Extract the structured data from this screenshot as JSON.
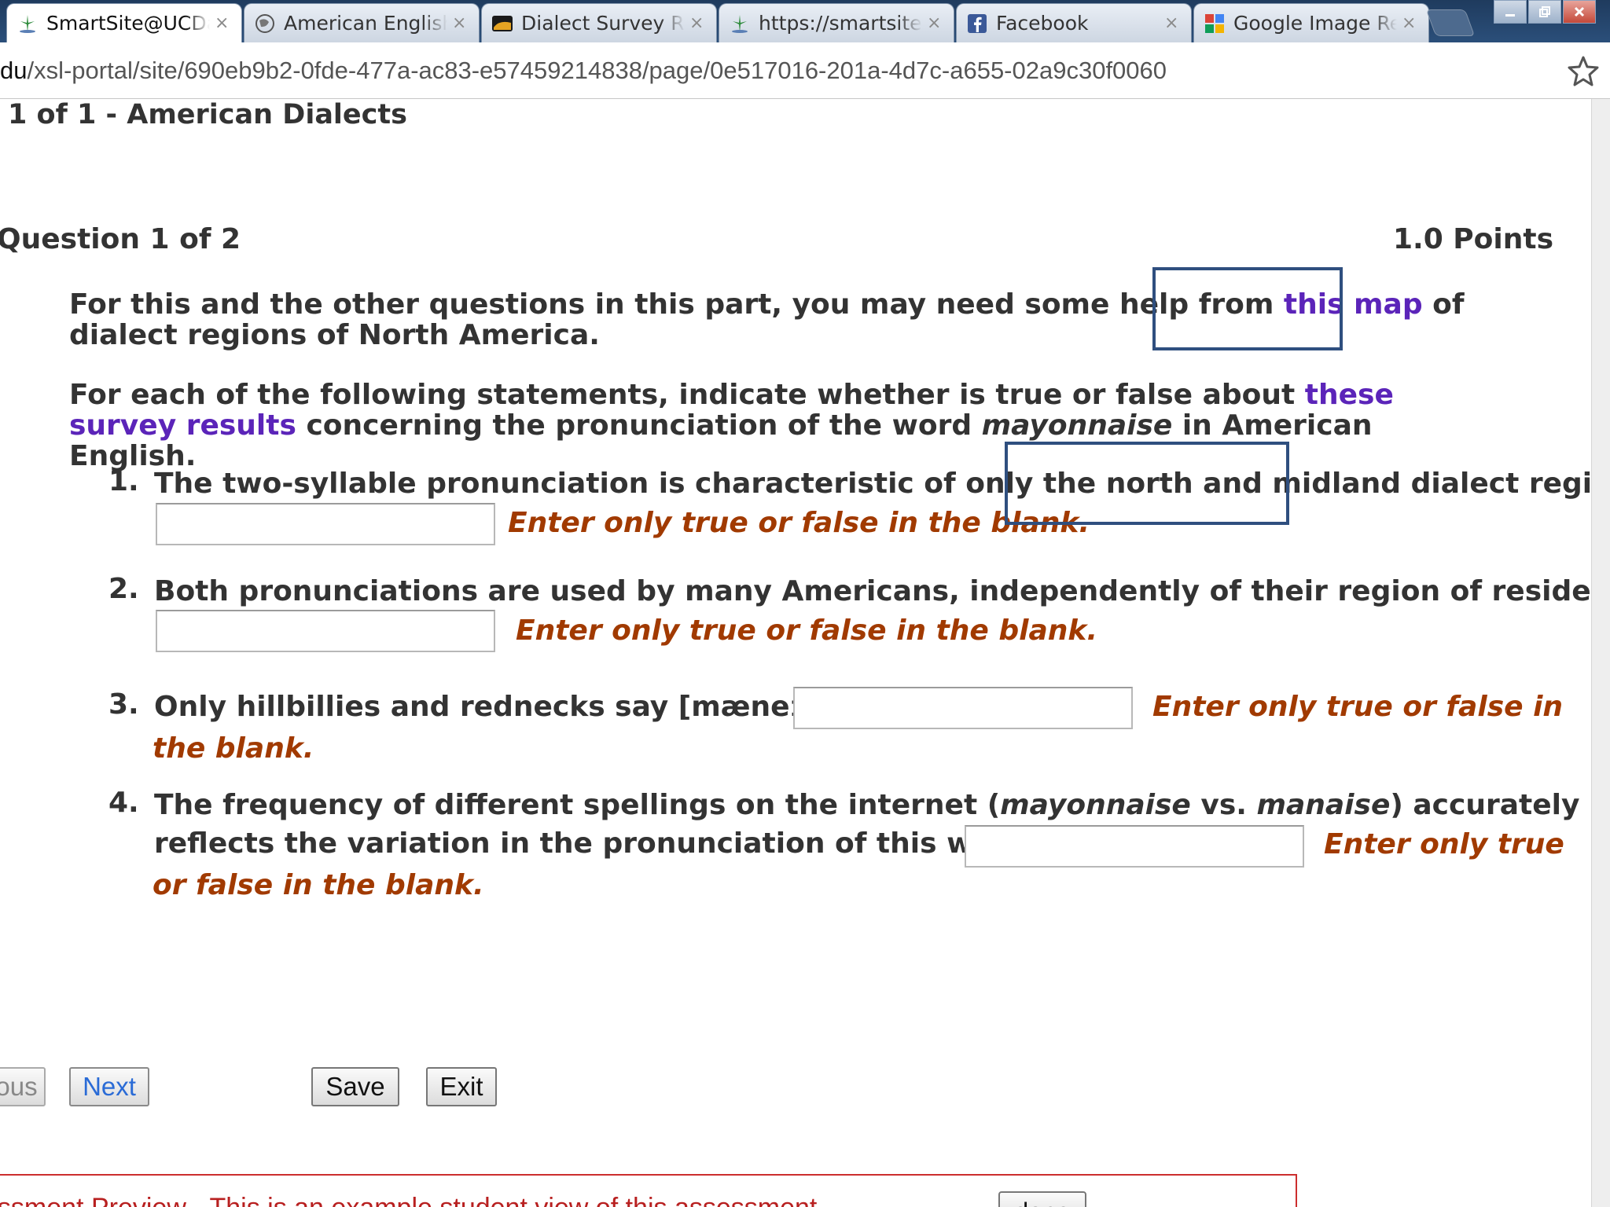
{
  "browser": {
    "tabs": [
      {
        "title": "SmartSite@UCDavis",
        "icon": "smartsite-icon",
        "active": true
      },
      {
        "title": "American English",
        "icon": "globe-icon",
        "active": false
      },
      {
        "title": "Dialect Survey Results",
        "icon": "dialect-survey-icon",
        "active": false
      },
      {
        "title": "https://smartsite.ucdavis.edu",
        "icon": "smartsite-icon",
        "active": false
      },
      {
        "title": "Facebook",
        "icon": "facebook-icon",
        "active": false
      },
      {
        "title": "Google Image Results",
        "icon": "google-icon",
        "active": false
      }
    ],
    "close_glyph": "×",
    "url_prefix": "du",
    "url_rest": "/xsl-portal/site/690eb9b2-0fde-477a-ac83-e57459214838/page/0e517016-201a-4d7c-a655-02a9c30f0060"
  },
  "page": {
    "part_title": "1 of 1 - American Dialects",
    "question_title": "Question 1 of 2",
    "points": "1.0 Points",
    "intro1": {
      "before": "For this and the other questions in this part, you may need some help from ",
      "link": "this map",
      "after": " of dialect regions of North America."
    },
    "intro2": {
      "before": "For each of the following statements, indicate whether is true or false about ",
      "link": "these survey results",
      "middle": " concerning the pronunciation of the word ",
      "word": "mayonnaise",
      "after": " in American English."
    },
    "hint": "Enter only true or false in the blank.",
    "items": [
      {
        "number": "1.",
        "text": "The two-syllable pronunciation is characteristic of only the north and midland dialect regions.",
        "value": ""
      },
      {
        "number": "2.",
        "text": "Both pronunciations are used by many Americans, independently of their region of residence.",
        "value": ""
      },
      {
        "number": "3.",
        "text": "Only hillbillies and rednecks say [mæneɪz].",
        "value": "",
        "hint_line1": "Enter only true or false in",
        "hint_line2": "the blank."
      },
      {
        "number": "4.",
        "text_a": "The frequency of different spellings on the internet (",
        "em1": "mayonnaise",
        "text_b": " vs. ",
        "em2": "manaise",
        "text_c": ") accurately",
        "text_line2": "reflects the variation in the pronunciation of this word.",
        "value": "",
        "hint_line1": "Enter only true",
        "hint_line2": "or false in the blank."
      }
    ],
    "buttons": {
      "previous": "ous",
      "next": "Next",
      "save": "Save",
      "exit": "Exit"
    },
    "preview_banner": {
      "text": "essment Preview - This is an example student view of this assessment",
      "done": "done"
    }
  },
  "colors": {
    "link": "#5b24b9",
    "hint": "#a13a00",
    "annotation": "#2f4f7f",
    "banner_border": "#cc2e2e"
  }
}
